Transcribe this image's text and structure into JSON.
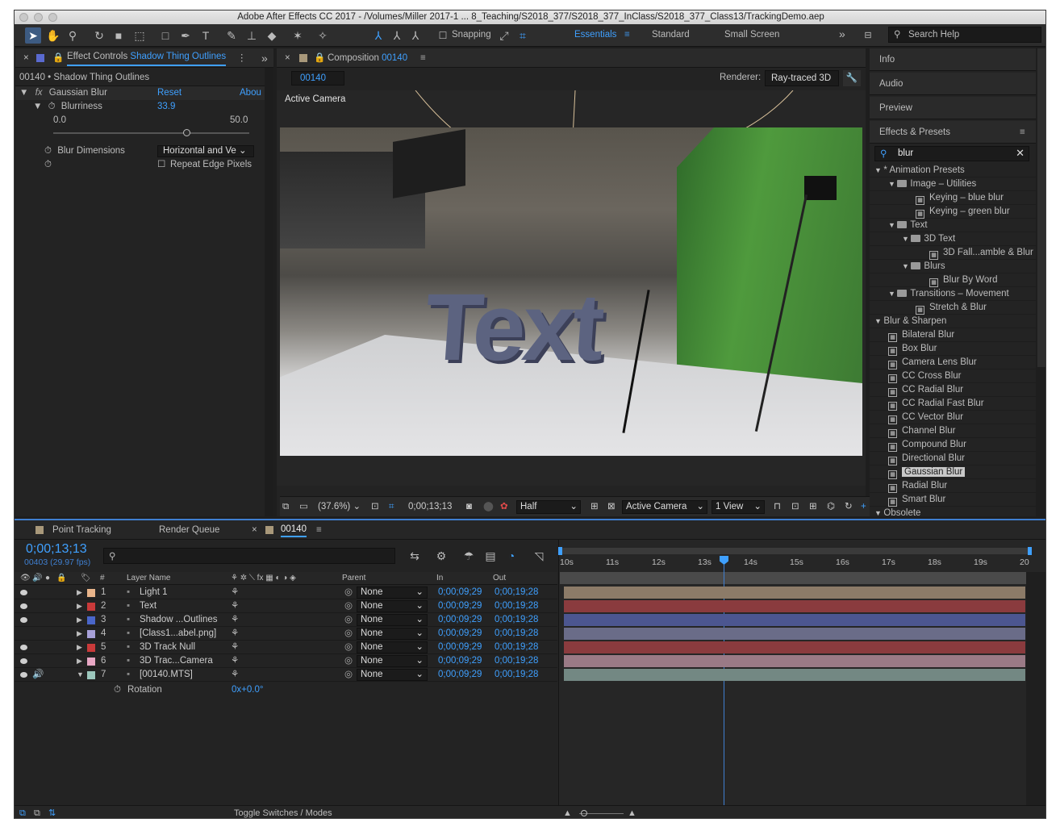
{
  "window": {
    "title": "Adobe After Effects CC 2017 - /Volumes/Miller 2017-1 ... 8_Teaching/S2018_377/S2018_377_InClass/S2018_377_Class13/TrackingDemo.aep"
  },
  "toolbar": {
    "snapping_label": "Snapping",
    "workspaces": [
      "Essentials",
      "Standard",
      "Small Screen"
    ],
    "search_help": "Search Help"
  },
  "effect_controls": {
    "tab_label": "Effect Controls",
    "tab_layer": "Shadow Thing Outlines",
    "breadcrumb": "00140 • Shadow Thing Outlines",
    "effect_name": "Gaussian Blur",
    "reset": "Reset",
    "about": "Abou",
    "blurriness_label": "Blurriness",
    "blurriness_value": "33.9",
    "slider_min": "0.0",
    "slider_max": "50.0",
    "slider_value": 0.678,
    "dimensions_label": "Blur Dimensions",
    "dimensions_value": "Horizontal and Ve",
    "repeat_edge_label": "Repeat Edge Pixels"
  },
  "composition": {
    "tab_label": "Composition",
    "tab_comp": "00140",
    "comp_chip": "00140",
    "renderer_label": "Renderer:",
    "renderer_value": "Ray-traced 3D",
    "active_camera_label": "Active Camera",
    "scene_text": "Text"
  },
  "viewer_controls": {
    "zoom": "(37.6%)",
    "timecode": "0;00;13;13",
    "resolution": "Half",
    "camera": "Active Camera",
    "views": "1 View"
  },
  "right_panels": {
    "info": "Info",
    "audio": "Audio",
    "preview": "Preview",
    "effects_presets": "Effects & Presets",
    "search_value": "blur"
  },
  "effects_tree": [
    {
      "label": "* Animation Presets",
      "type": "root",
      "indent": 0
    },
    {
      "label": "Image – Utilities",
      "type": "folder",
      "indent": 1
    },
    {
      "label": "Keying – blue blur",
      "type": "item",
      "indent": 3
    },
    {
      "label": "Keying – green blur",
      "type": "item",
      "indent": 3
    },
    {
      "label": "Text",
      "type": "folder",
      "indent": 1
    },
    {
      "label": "3D Text",
      "type": "folder",
      "indent": 2
    },
    {
      "label": "3D Fall...amble & Blur",
      "type": "item",
      "indent": 4
    },
    {
      "label": "Blurs",
      "type": "folder",
      "indent": 2
    },
    {
      "label": "Blur By Word",
      "type": "item",
      "indent": 4
    },
    {
      "label": "Transitions – Movement",
      "type": "folder",
      "indent": 1
    },
    {
      "label": "Stretch & Blur",
      "type": "item",
      "indent": 3
    },
    {
      "label": "Blur & Sharpen",
      "type": "root",
      "indent": 0
    },
    {
      "label": "Bilateral Blur",
      "type": "item",
      "indent": 1
    },
    {
      "label": "Box Blur",
      "type": "item",
      "indent": 1
    },
    {
      "label": "Camera Lens Blur",
      "type": "item",
      "indent": 1
    },
    {
      "label": "CC Cross Blur",
      "type": "item",
      "indent": 1
    },
    {
      "label": "CC Radial Blur",
      "type": "item",
      "indent": 1
    },
    {
      "label": "CC Radial Fast Blur",
      "type": "item",
      "indent": 1
    },
    {
      "label": "CC Vector Blur",
      "type": "item",
      "indent": 1
    },
    {
      "label": "Channel Blur",
      "type": "item",
      "indent": 1
    },
    {
      "label": "Compound Blur",
      "type": "item",
      "indent": 1
    },
    {
      "label": "Directional Blur",
      "type": "item",
      "indent": 1
    },
    {
      "label": "Gaussian Blur",
      "type": "item",
      "indent": 1,
      "selected": true
    },
    {
      "label": "Radial Blur",
      "type": "item",
      "indent": 1
    },
    {
      "label": "Smart Blur",
      "type": "item",
      "indent": 1
    },
    {
      "label": "Obsolete",
      "type": "root",
      "indent": 0
    }
  ],
  "timeline": {
    "tabs": [
      "Point Tracking",
      "Render Queue",
      "00140"
    ],
    "timecode": "0;00;13;13",
    "frames_fps": "00403 (29.97 fps)",
    "ruler": [
      "10s",
      "11s",
      "12s",
      "13s",
      "14s",
      "15s",
      "16s",
      "17s",
      "18s",
      "19s",
      "20"
    ],
    "col_num": "#",
    "col_layer": "Layer Name",
    "col_parent": "Parent",
    "col_in": "In",
    "col_out": "Out",
    "layers": [
      {
        "num": "1",
        "name": "Light 1",
        "color": "#e8b48a",
        "parent": "None",
        "in": "0;00;09;29",
        "out": "0;00;19;28",
        "bar": "#8c7b68"
      },
      {
        "num": "2",
        "name": "Text",
        "color": "#c93a3a",
        "parent": "None",
        "in": "0;00;09;29",
        "out": "0;00;19;28",
        "bar": "#8a3b3e"
      },
      {
        "num": "3",
        "name": "Shadow ...Outlines",
        "color": "#4a66c9",
        "parent": "None",
        "in": "0;00;09;29",
        "out": "0;00;19;28",
        "bar": "#4c5690"
      },
      {
        "num": "4",
        "name": "[Class1...abel.png]",
        "color": "#a7a0d8",
        "parent": "None",
        "in": "0;00;09;29",
        "out": "0;00;19;28",
        "bar": "#6a6c88"
      },
      {
        "num": "5",
        "name": "3D Track Null",
        "color": "#c93a3a",
        "parent": "None",
        "in": "0;00;09;29",
        "out": "0;00;19;28",
        "bar": "#8a3b3e"
      },
      {
        "num": "6",
        "name": "3D Trac...Camera",
        "color": "#e8a7c4",
        "parent": "None",
        "in": "0;00;09;29",
        "out": "0;00;19;28",
        "bar": "#9a7a86"
      },
      {
        "num": "7",
        "name": "[00140.MTS]",
        "color": "#9cc7bd",
        "parent": "None",
        "in": "0;00;09;29",
        "out": "0;00;19;28",
        "bar": "#738883"
      }
    ],
    "rotation_label": "Rotation",
    "rotation_value": "0x+0.0°",
    "toggle_label": "Toggle Switches / Modes"
  },
  "colors": {
    "accent": "#3fa0ff",
    "panel": "#232323",
    "selection": "#3d5b82"
  }
}
